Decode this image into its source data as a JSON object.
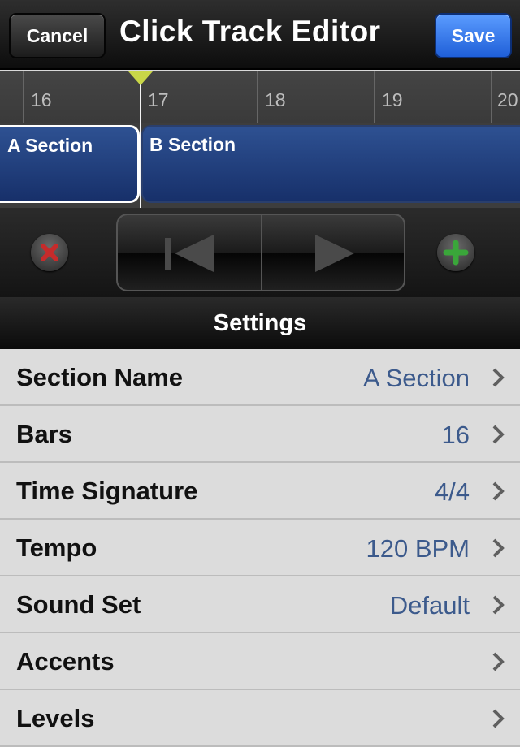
{
  "navbar": {
    "cancel_label": "Cancel",
    "title": "Click Track Editor",
    "save_label": "Save"
  },
  "timeline": {
    "bar_numbers": [
      "16",
      "17",
      "18",
      "19",
      "20"
    ],
    "sections": [
      {
        "name": "A Section",
        "selected": true
      },
      {
        "name": "B Section",
        "selected": false
      }
    ],
    "playhead_color": "#c9d648"
  },
  "transport": {
    "delete_icon": "red-x-icon",
    "previous_icon": "previous-arrow-icon",
    "next_icon": "next-arrow-icon",
    "add_icon": "green-plus-icon"
  },
  "settings": {
    "header": "Settings",
    "rows": [
      {
        "label": "Section Name",
        "value": "A Section"
      },
      {
        "label": "Bars",
        "value": "16"
      },
      {
        "label": "Time Signature",
        "value": "4/4"
      },
      {
        "label": "Tempo",
        "value": "120 BPM"
      },
      {
        "label": "Sound Set",
        "value": "Default"
      },
      {
        "label": "Accents",
        "value": ""
      },
      {
        "label": "Levels",
        "value": ""
      }
    ]
  },
  "colors": {
    "accent_blue": "#1f5fd8",
    "section_blue": "#2e5192",
    "value_text": "#3c5a8c"
  }
}
